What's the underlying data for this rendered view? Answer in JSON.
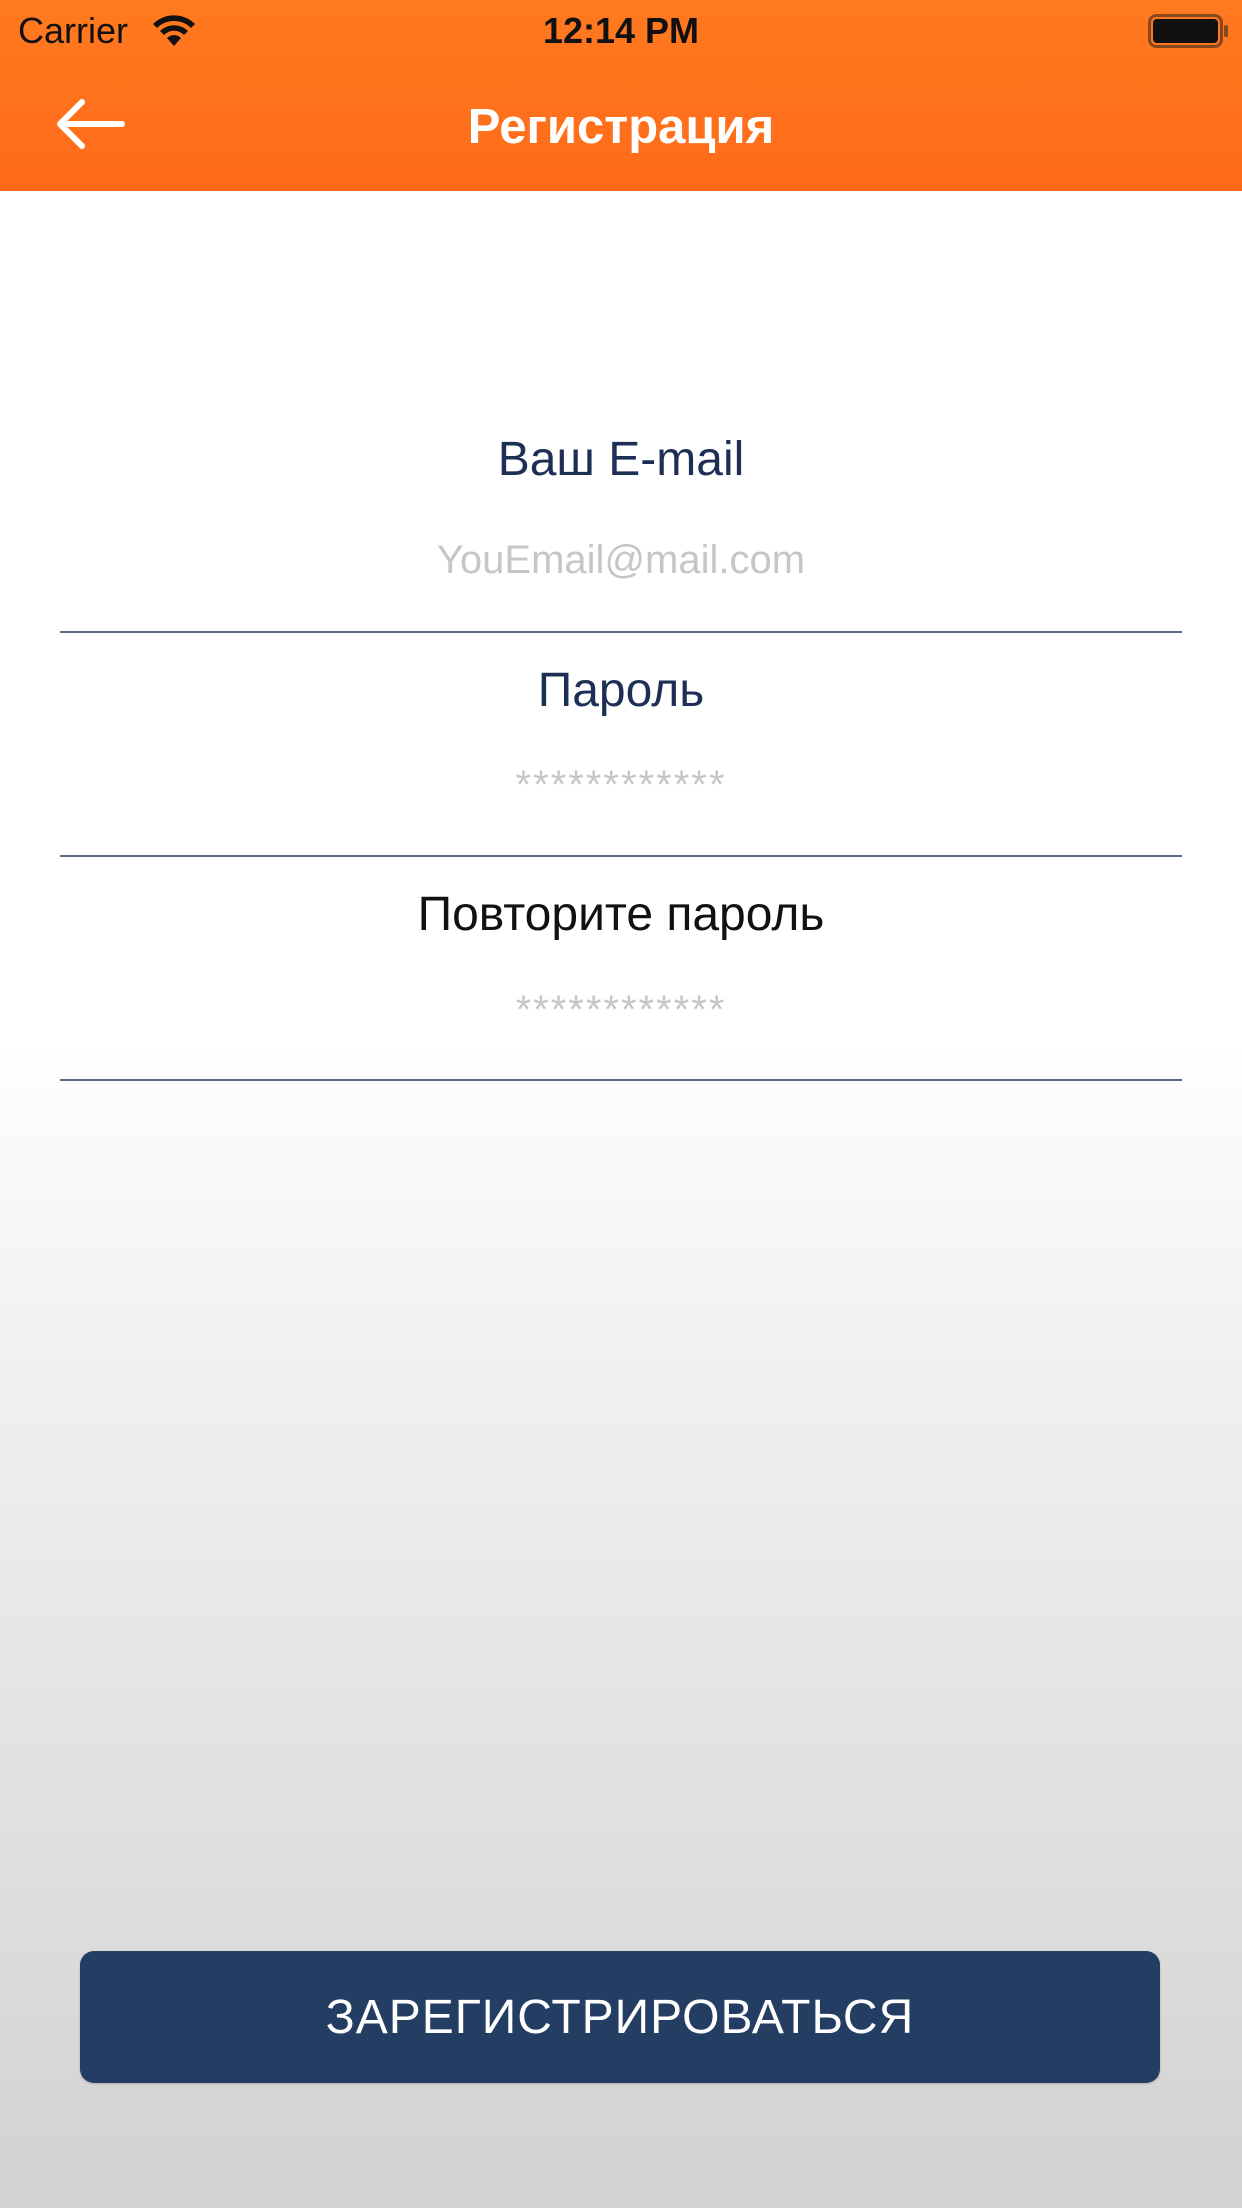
{
  "status_bar": {
    "carrier": "Carrier",
    "time": "12:14 PM",
    "wifi_icon": "wifi-icon",
    "battery_icon": "battery-full-icon"
  },
  "nav": {
    "title": "Регистрация",
    "back_icon": "arrow-left-icon",
    "background_color": "#ff6f1c"
  },
  "form": {
    "email": {
      "label": "Ваш E-mail",
      "placeholder": "YouEmail@mail.com",
      "value": ""
    },
    "password": {
      "label": "Пароль",
      "placeholder": "************",
      "value": ""
    },
    "repeat_password": {
      "label": "Повторите пароль",
      "placeholder": "************",
      "value": ""
    }
  },
  "actions": {
    "register_label": "ЗАРЕГИСТРИРОВАТЬСЯ",
    "register_color": "#243d63"
  }
}
